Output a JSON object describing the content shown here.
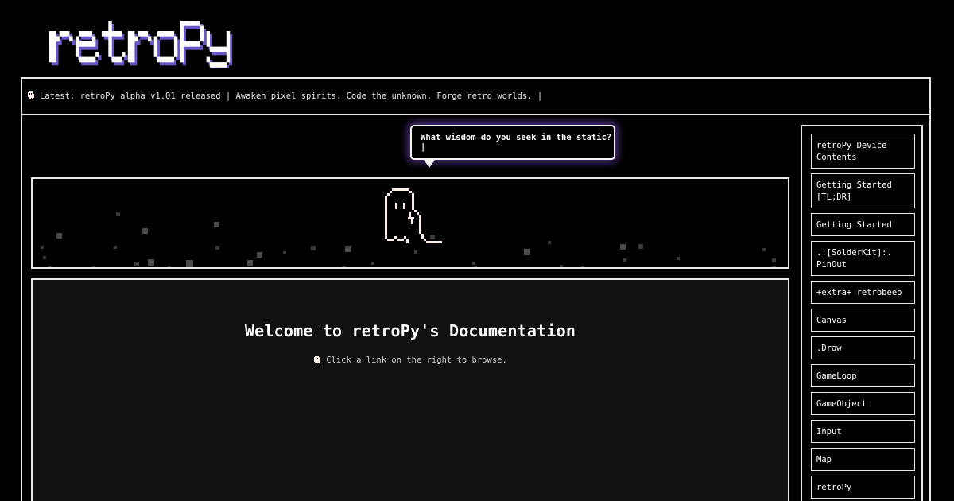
{
  "logo": {
    "text": "retroPy"
  },
  "ticker": {
    "icon": "ghost-icon",
    "text": "Latest: retroPy alpha v1.01 released | Awaken pixel spirits. Code the unknown. Forge retro worlds. |"
  },
  "bubble": {
    "text": "What wisdom do you seek in the static? |"
  },
  "content": {
    "title": "Welcome to retroPy's Documentation",
    "hint_icon": "ghost-icon",
    "hint": "Click a link on the right to browse."
  },
  "sidebar": {
    "items": [
      {
        "label": "retroPy Device Contents"
      },
      {
        "label": "Getting Started [TL;DR]"
      },
      {
        "label": "Getting Started"
      },
      {
        "label": ".:[SolderKit]:. PinOut"
      },
      {
        "label": "+extra+ retrobeep"
      },
      {
        "label": "Canvas"
      },
      {
        "label": ".Draw"
      },
      {
        "label": "GameLoop"
      },
      {
        "label": "GameObject"
      },
      {
        "label": "Input"
      },
      {
        "label": "Map"
      },
      {
        "label": "retroPy"
      }
    ]
  },
  "colors": {
    "background": "#000000",
    "panel": "#111111",
    "border": "#e8e8e8",
    "glow": "#7e50d2",
    "ghost": "#fbeee6",
    "logo_shadow": "#6a55c8"
  }
}
